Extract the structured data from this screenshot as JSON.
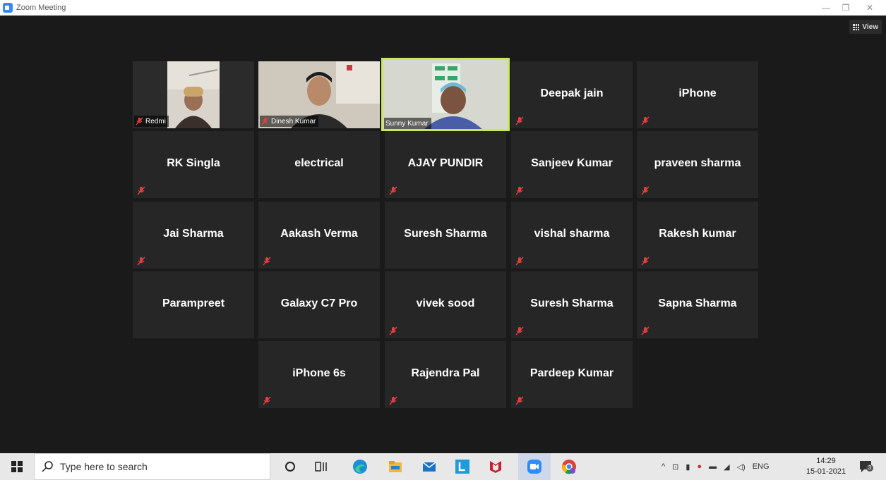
{
  "window": {
    "title": "Zoom Meeting",
    "minimize_glyph": "—",
    "restore_glyph": "❐",
    "close_glyph": "✕"
  },
  "toolbar": {
    "view_label": "View"
  },
  "participants": {
    "video_names": [
      "Redmi",
      "Dinesh Kumar",
      "Sunny Kumar"
    ],
    "row1": [
      "Deepak jain",
      "iPhone"
    ],
    "row2": [
      "RK Singla",
      "electrical",
      "AJAY PUNDIR",
      "Sanjeev Kumar",
      "praveen sharma"
    ],
    "row3": [
      "Jai Sharma",
      "Aakash Verma",
      "Suresh Sharma",
      "vishal sharma",
      "Rakesh kumar"
    ],
    "row4": [
      "Parampreet",
      "Galaxy C7 Pro",
      "vivek sood",
      "Suresh Sharma",
      "Sapna Sharma"
    ],
    "row5": [
      "iPhone 6s",
      "Rajendra Pal",
      "Pardeep Kumar"
    ]
  },
  "taskbar": {
    "search_placeholder": "Type here to search",
    "language": "ENG",
    "time": "14:29",
    "date": "15-01-2021",
    "notification_count": "3"
  },
  "colors": {
    "active_speaker_border": "#c6e85a",
    "muted_icon": "#e04040",
    "zoom_blue": "#2d8cff"
  },
  "icons": [
    "windows-start-icon",
    "search-icon",
    "cortana-icon",
    "task-view-icon",
    "edge-icon",
    "file-explorer-icon",
    "mail-icon",
    "lens-icon",
    "mcafee-icon",
    "zoom-icon",
    "chrome-icon",
    "muted-mic-icon"
  ]
}
